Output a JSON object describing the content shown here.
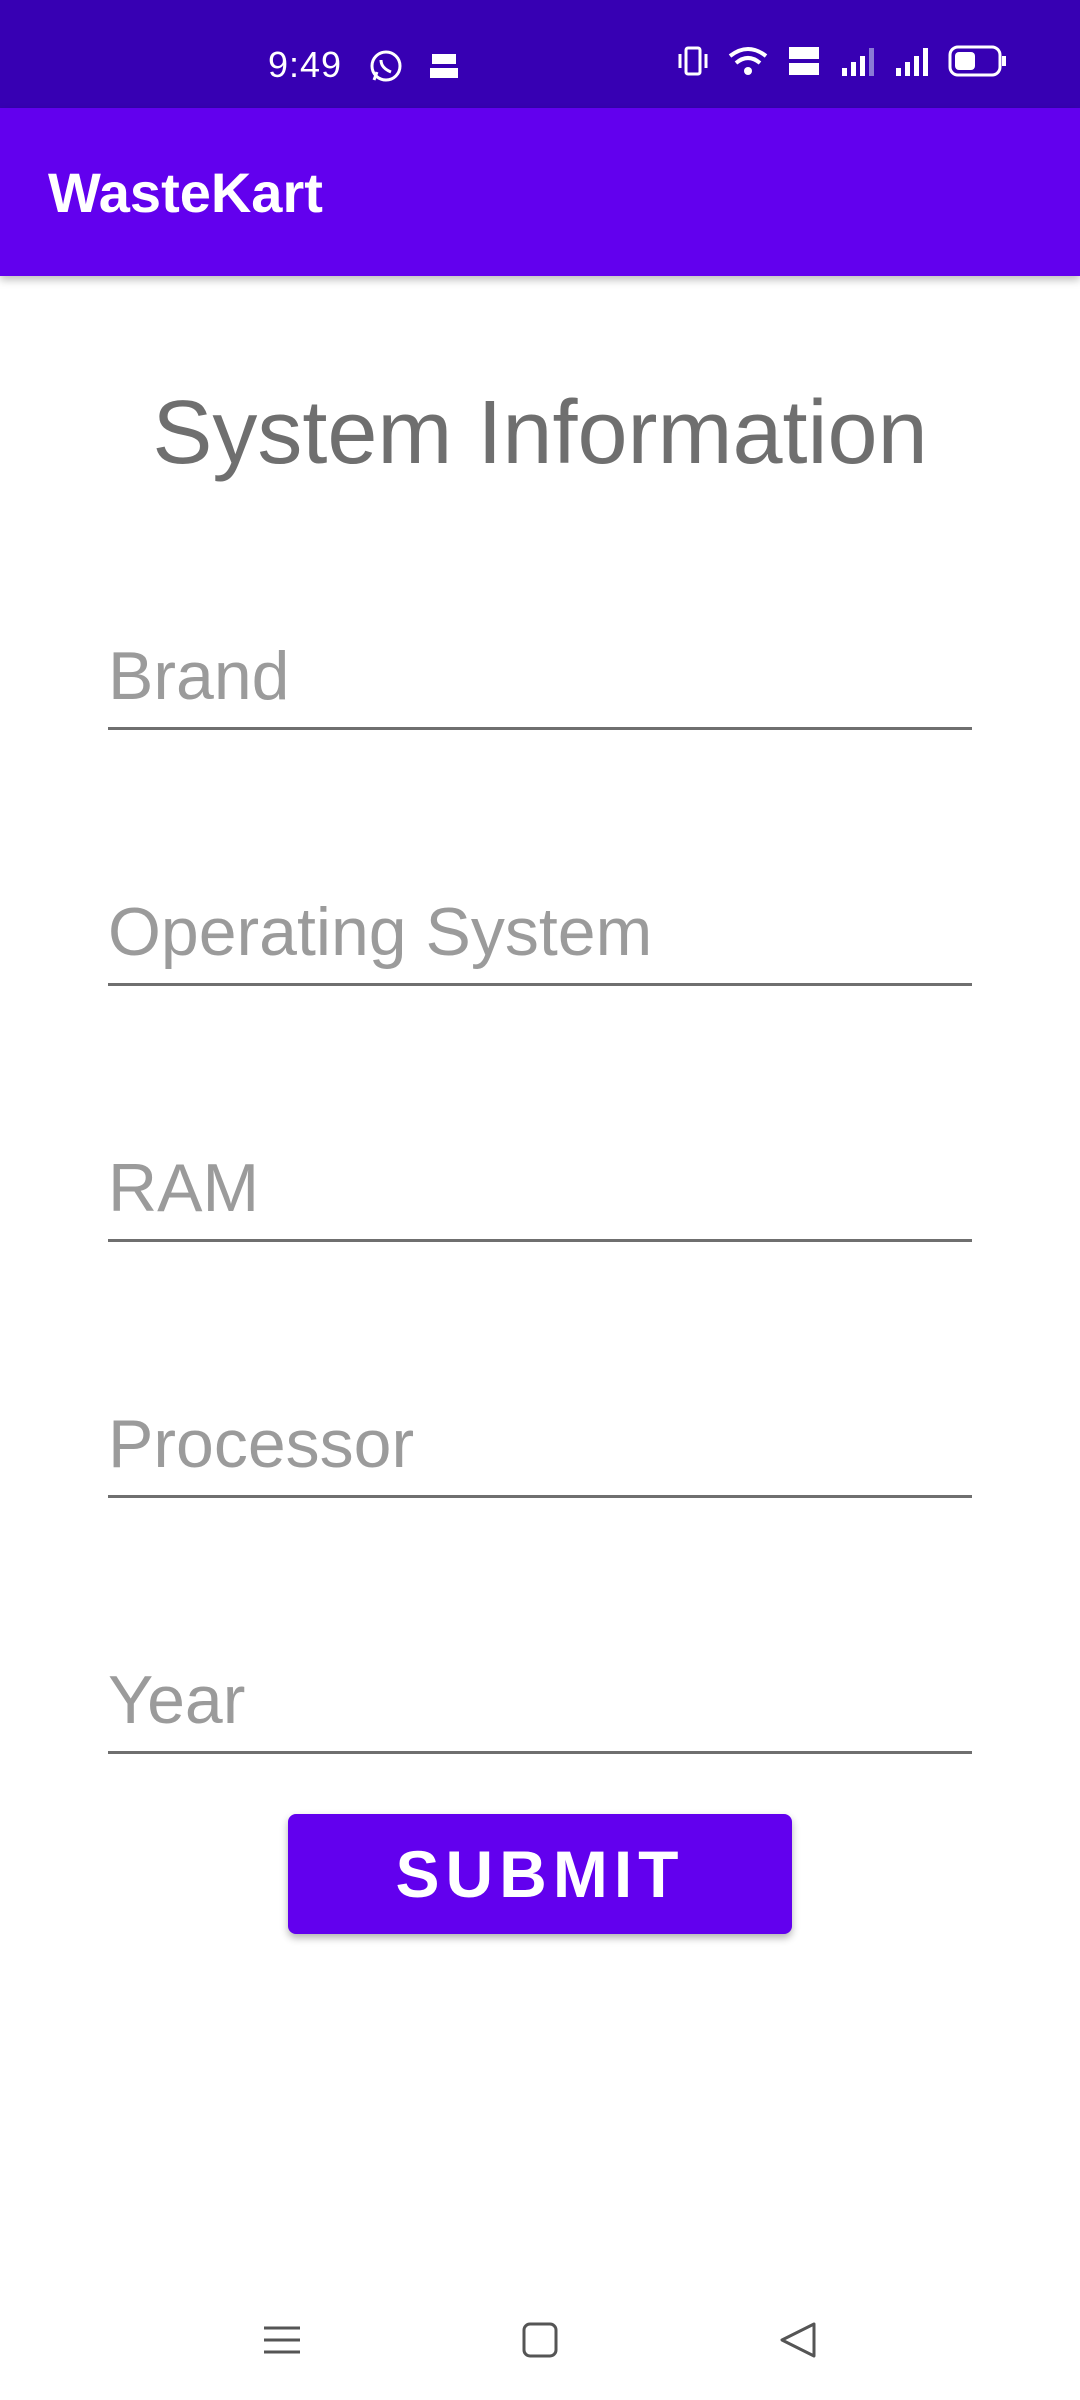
{
  "status_bar": {
    "time": "9:49",
    "left_icons": [
      "whatsapp-icon",
      "news-app-icon"
    ],
    "right_icons": [
      "vibrate-icon",
      "wifi-icon",
      "volte-icon",
      "signal-icon",
      "signal-icon",
      "battery-icon"
    ]
  },
  "app_bar": {
    "title": "WasteKart"
  },
  "form": {
    "title": "System Information",
    "fields": [
      {
        "placeholder": "Brand",
        "value": ""
      },
      {
        "placeholder": "Operating System",
        "value": ""
      },
      {
        "placeholder": "RAM",
        "value": ""
      },
      {
        "placeholder": "Processor",
        "value": ""
      },
      {
        "placeholder": "Year",
        "value": ""
      }
    ],
    "submit_label": "SUBMIT"
  },
  "nav_bar": {
    "icons": [
      "menu-icon",
      "home-icon",
      "back-icon"
    ]
  },
  "colors": {
    "status_bar": "#3700b3",
    "primary": "#6200ee",
    "title_text": "#6f6f6f",
    "placeholder_text": "#9b9b9b"
  }
}
